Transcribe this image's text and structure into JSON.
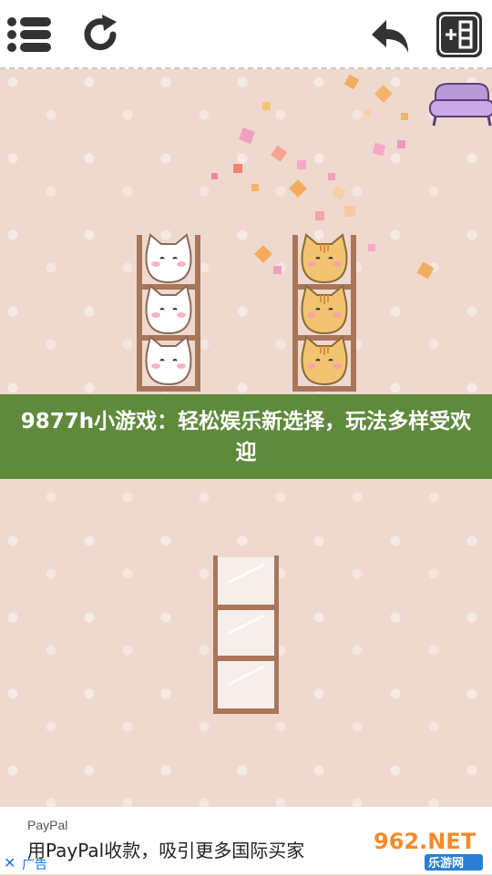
{
  "toolbar": {
    "menu_icon": "menu-list-icon",
    "restart_icon": "restart-icon",
    "undo_icon": "undo-icon",
    "add_shelf_icon": "add-shelf-icon"
  },
  "game": {
    "shelves": [
      {
        "cats": [
          "white",
          "white",
          "white"
        ]
      },
      {
        "cats": [
          "orange",
          "orange",
          "orange"
        ]
      },
      {
        "cats": []
      }
    ],
    "decor_icon": "sofa-icon"
  },
  "banner": {
    "text": "9877h小游戏：轻松娱乐新选择，玩法多样受欢迎"
  },
  "ad": {
    "brand": "PayPal",
    "text": "用PayPal收款，吸引更多国际买家",
    "label": "广告",
    "close_icon": "close-icon"
  },
  "watermark": {
    "logo_text": "962.NET",
    "site_text": "乐游网"
  },
  "colors": {
    "background": "#efd8cc",
    "banner": "#5f8a3c",
    "shelf_wood": "#a8765a",
    "white_cat": "#ffffff",
    "orange_cat": "#f2c370"
  }
}
